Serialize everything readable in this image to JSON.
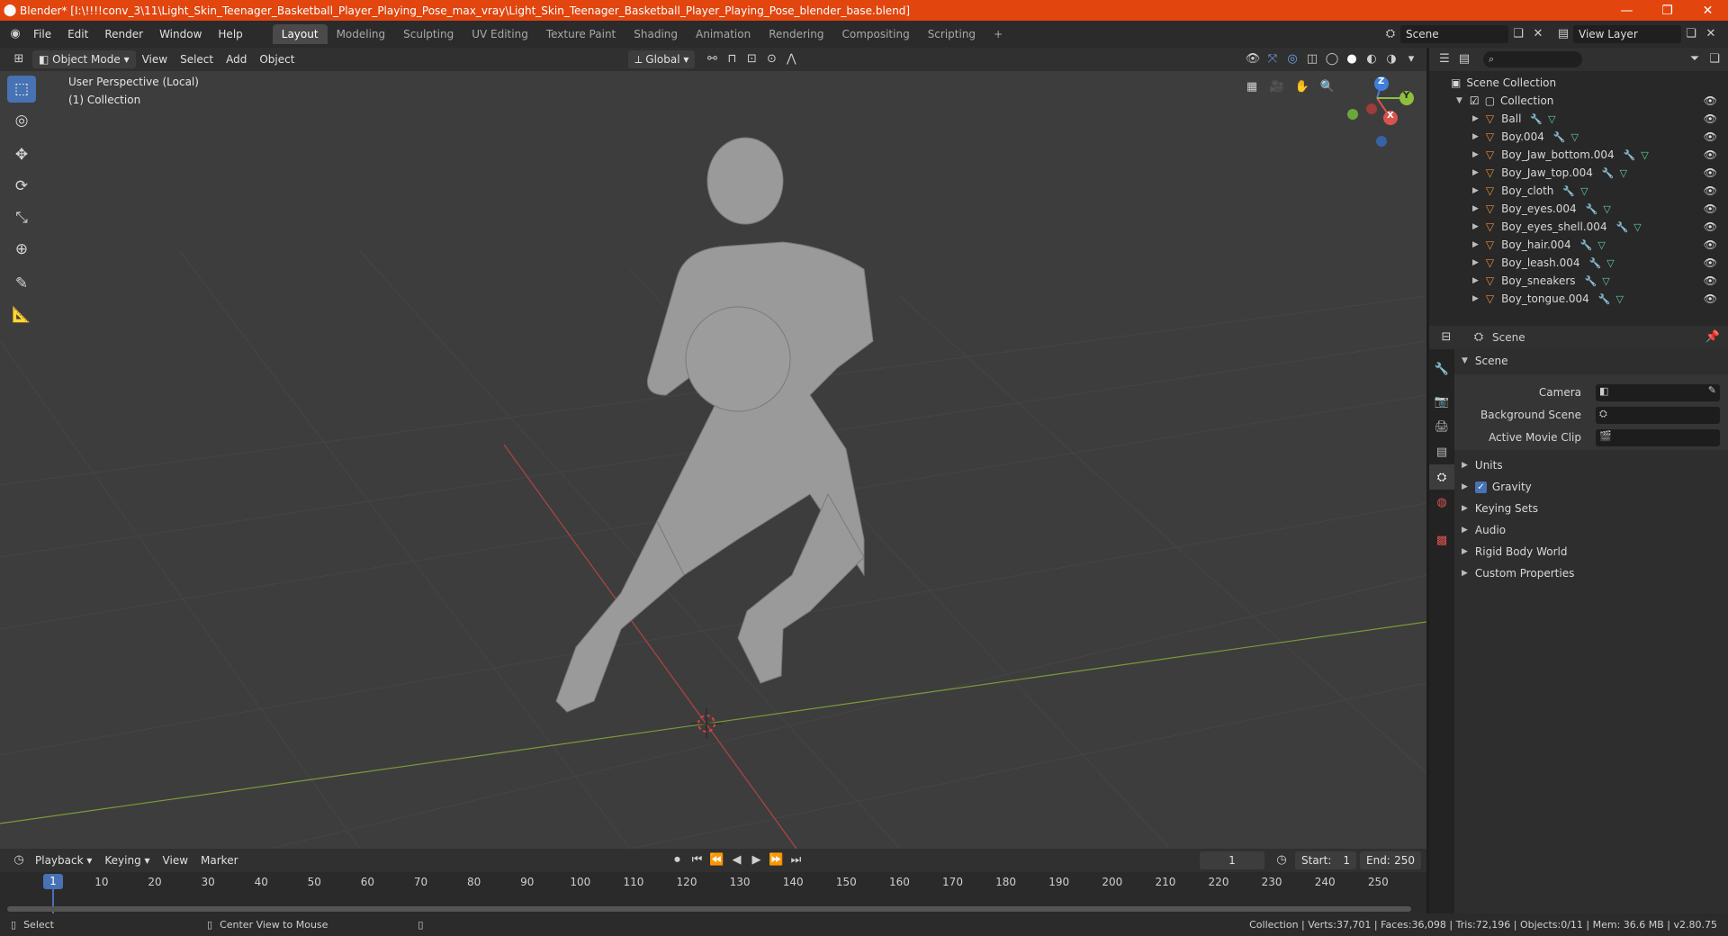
{
  "title_bar": {
    "title": "Blender* [I:\\!!!!conv_3\\11\\Light_Skin_Teenager_Basketball_Player_Playing_Pose_max_vray\\Light_Skin_Teenager_Basketball_Player_Playing_Pose_blender_base.blend]",
    "minimize": "—",
    "maximize": "❐",
    "close": "✕"
  },
  "menu": [
    "File",
    "Edit",
    "Render",
    "Window",
    "Help"
  ],
  "workspaces": [
    "Layout",
    "Modeling",
    "Sculpting",
    "UV Editing",
    "Texture Paint",
    "Shading",
    "Animation",
    "Rendering",
    "Compositing",
    "Scripting"
  ],
  "workspace_add": "+",
  "top_right": {
    "scene": "Scene",
    "view_layer": "View Layer"
  },
  "viewport_header": {
    "mode": "Object Mode",
    "menus": [
      "View",
      "Select",
      "Add",
      "Object"
    ],
    "transform_orientation": "Global"
  },
  "viewport": {
    "perspective": "User Perspective (Local)",
    "collection": "(1) Collection",
    "axis_labels": {
      "z": "Z",
      "x": "X",
      "y": "Y"
    }
  },
  "outliner": {
    "search_placeholder": "",
    "scene_collection": "Scene Collection",
    "collection": "Collection",
    "items": [
      "Ball",
      "Boy.004",
      "Boy_Jaw_bottom.004",
      "Boy_Jaw_top.004",
      "Boy_cloth",
      "Boy_eyes.004",
      "Boy_eyes_shell.004",
      "Boy_hair.004",
      "Boy_leash.004",
      "Boy_sneakers",
      "Boy_tongue.004"
    ]
  },
  "properties": {
    "header": "Scene",
    "panel_title": "Scene",
    "fields": [
      {
        "label": "Camera"
      },
      {
        "label": "Background Scene"
      },
      {
        "label": "Active Movie Clip"
      }
    ],
    "subpanels": [
      "Units",
      "Gravity",
      "Keying Sets",
      "Audio",
      "Rigid Body World",
      "Custom Properties"
    ],
    "gravity_checked": true
  },
  "timeline": {
    "menus": [
      "Playback",
      "Keying",
      "View",
      "Marker"
    ],
    "current_frame": "1",
    "start_label": "Start:",
    "start": "1",
    "end_label": "End:",
    "end": "250",
    "frame_marks": [
      "10",
      "20",
      "30",
      "40",
      "50",
      "60",
      "70",
      "80",
      "90",
      "100",
      "110",
      "120",
      "130",
      "140",
      "150",
      "160",
      "170",
      "180",
      "190",
      "200",
      "210",
      "220",
      "230",
      "240",
      "250"
    ],
    "playhead_label": "1"
  },
  "status_bar": {
    "left_action": "Select",
    "middle_action": "Center View to Mouse",
    "stats": "Collection | Verts:37,701 | Faces:36,098 | Tris:72,196 | Objects:0/11 | Mem: 36.6 MB | v2.80.75"
  },
  "colors": {
    "accent": "#4772b3",
    "title_bar": "#e2450e",
    "mesh_orange": "#e88f3b",
    "x_axis": "#d9534f",
    "y_axis": "#8fbf3f",
    "z_axis": "#3f7fd9"
  }
}
